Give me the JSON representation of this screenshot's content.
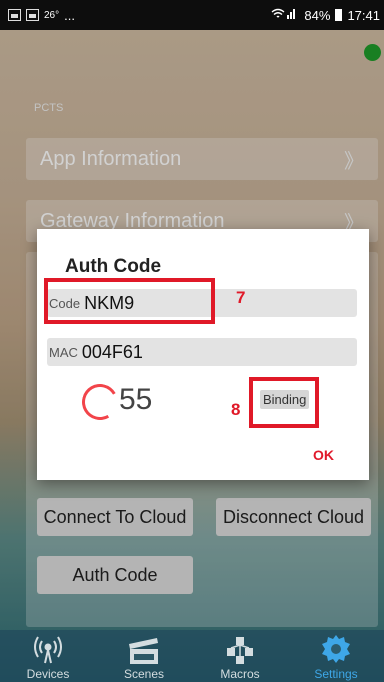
{
  "status_bar": {
    "temp": "26°",
    "dots": "...",
    "battery": "84%",
    "time": "17:41"
  },
  "section_label": "PCTS",
  "rows": [
    {
      "label": "App Information"
    },
    {
      "label": "Gateway Information"
    }
  ],
  "buttons": {
    "connect": "Connect To Cloud",
    "disconnect": "Disconnect Cloud",
    "auth": "Auth Code"
  },
  "dialog": {
    "title": "Auth Code",
    "code_label": "Code",
    "code_value": "NKM9",
    "mac_label": "MAC",
    "mac_value": "004F61",
    "countdown": "55",
    "binding_label": "Binding",
    "ok_label": "OK"
  },
  "annotations": {
    "box_7": "7",
    "box_8": "8"
  },
  "nav": {
    "items": [
      {
        "label": "Devices"
      },
      {
        "label": "Scenes"
      },
      {
        "label": "Macros"
      },
      {
        "label": "Settings"
      }
    ]
  },
  "colors": {
    "accent_red": "#e01928",
    "status_green": "#1f9b2a",
    "nav_active": "#3ea7e8"
  }
}
